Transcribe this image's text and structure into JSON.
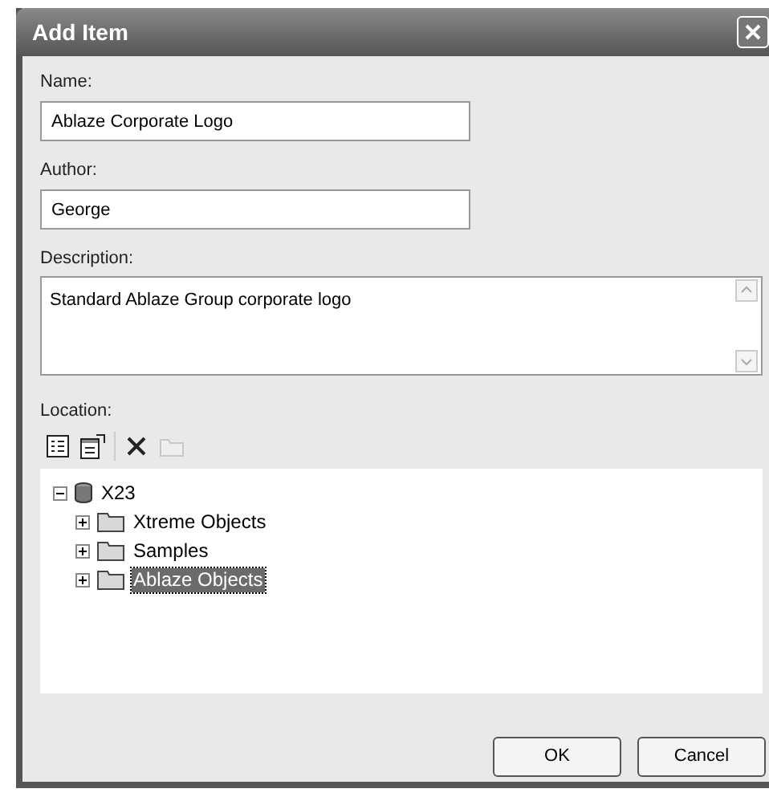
{
  "window": {
    "title": "Add Item"
  },
  "fields": [
    {
      "label": "Name:",
      "value": "Ablaze Corporate Logo"
    },
    {
      "label": "Author:",
      "value": "George"
    }
  ],
  "description": {
    "label": "Description:",
    "value": "Standard Ablaze Group corporate logo"
  },
  "location": {
    "label": "Location:",
    "toolbar": [
      {
        "kind": "list",
        "disabled": false
      },
      {
        "kind": "properties",
        "disabled": false
      },
      {
        "kind": "delete",
        "disabled": false
      },
      {
        "kind": "folder",
        "disabled": true
      }
    ],
    "tree": [
      {
        "label": "X23",
        "kind": "database",
        "expanded": true,
        "selected": false,
        "children": [
          {
            "label": "Xtreme Objects",
            "kind": "folder",
            "expanded": false,
            "selected": false
          },
          {
            "label": "Samples",
            "kind": "folder",
            "expanded": false,
            "selected": false
          },
          {
            "label": "Ablaze Objects",
            "kind": "folder",
            "expanded": false,
            "selected": true
          }
        ]
      }
    ]
  },
  "buttons": [
    "OK",
    "Cancel"
  ]
}
